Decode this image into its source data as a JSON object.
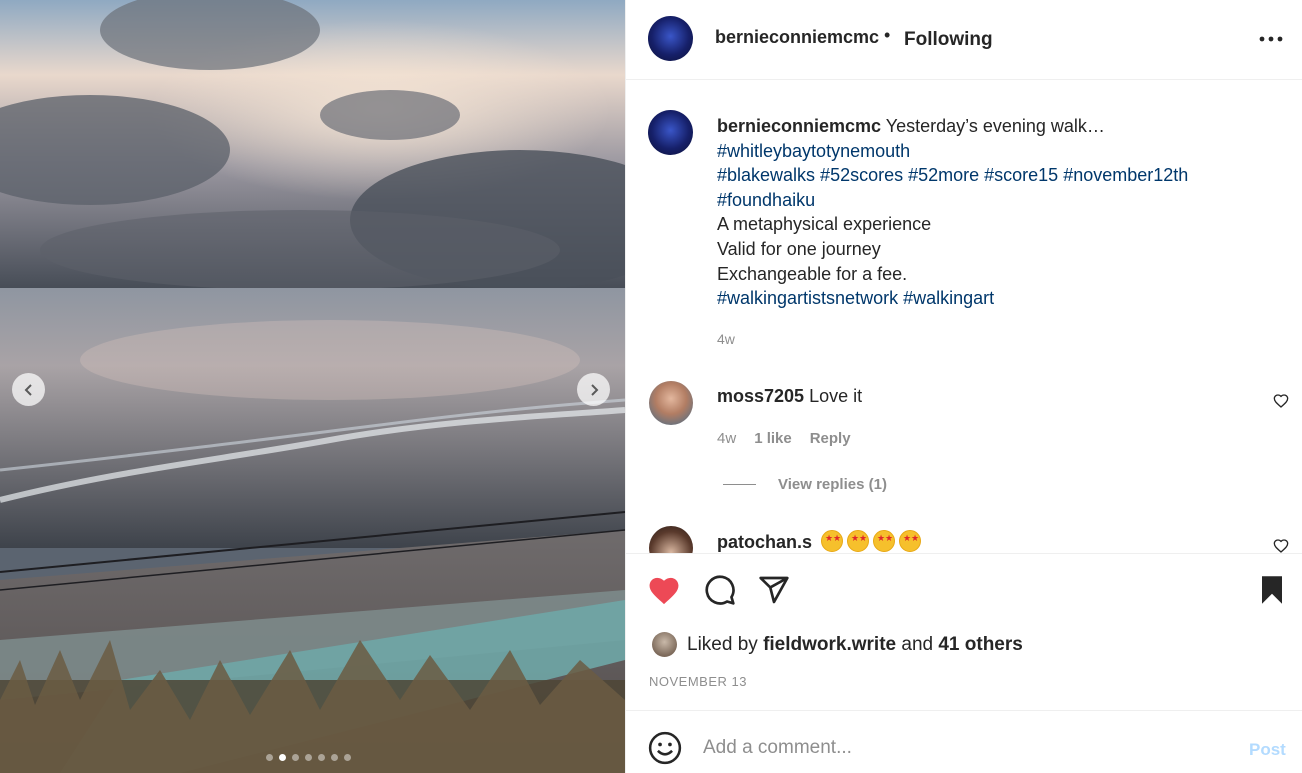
{
  "post": {
    "owner": "bernieconniemcmc",
    "follow_status": "Following",
    "separator": "•",
    "more_icon": "more-horizontal-icon",
    "caption": {
      "username": "bernieconniemcmc",
      "lines": [
        {
          "text": "Yesterday’s evening walk…",
          "type": "text"
        },
        {
          "text": "#whitleybaytotynemouth",
          "type": "tag"
        },
        {
          "text": "#blakewalks #52scores #52more #score15 #november12th",
          "type": "tag"
        },
        {
          "text": "#foundhaiku",
          "type": "tag"
        },
        {
          "text": "A metaphysical experience",
          "type": "text"
        },
        {
          "text": "Valid for one journey",
          "type": "text"
        },
        {
          "text": "Exchangeable for a fee.",
          "type": "text"
        },
        {
          "text": "#walkingartistsnetwork #walkingart",
          "type": "tag"
        }
      ],
      "time": "4w"
    },
    "comments": [
      {
        "username": "moss7205",
        "text": "Love it",
        "time": "4w",
        "likes": "1 like",
        "reply_label": "Reply",
        "view_replies": "View replies (1)"
      },
      {
        "username": "patochan.s",
        "emoji_count": 4,
        "emoji_name": "star-struck-emoji"
      }
    ],
    "carousel": {
      "total": 7,
      "active_index": 1
    },
    "actions": {
      "like_icon": "heart-filled-icon",
      "comment_icon": "comment-icon",
      "share_icon": "send-icon",
      "save_icon": "bookmark-filled-icon",
      "like_color": "#ed4956"
    },
    "likes": {
      "prefix": "Liked by",
      "user": "fieldwork.write",
      "conj": "and",
      "others": "41 others"
    },
    "date": "NOVEMBER 13",
    "add_comment": {
      "placeholder": "Add a comment...",
      "post_label": "Post",
      "emoji_icon": "smile-icon"
    }
  }
}
